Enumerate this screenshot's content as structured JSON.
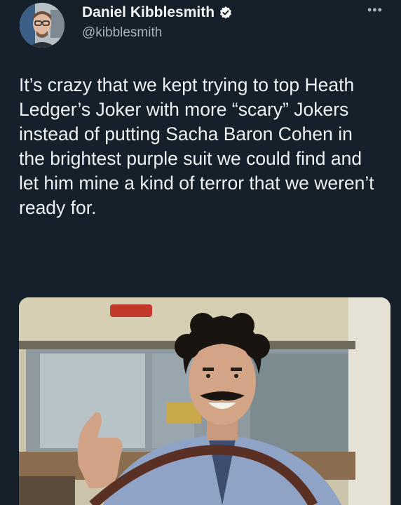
{
  "tweet": {
    "display_name": "Daniel Kibblesmith",
    "handle": "@kibblesmith",
    "text": "It’s crazy that we kept trying to top Heath Ledger’s Joker with more “scary” Jokers instead of putting Sacha Baron Cohen in the brightest purple suit we could find and let him mine a kind of terror that we weren’t ready for.",
    "more_icon": "more-horizontal-icon",
    "verified_icon": "verified-badge-icon"
  },
  "colors": {
    "background": "#15202b",
    "text": "#e7e9ea",
    "secondary_text": "#a9b2ba",
    "verified_badge": "#ffffff"
  }
}
